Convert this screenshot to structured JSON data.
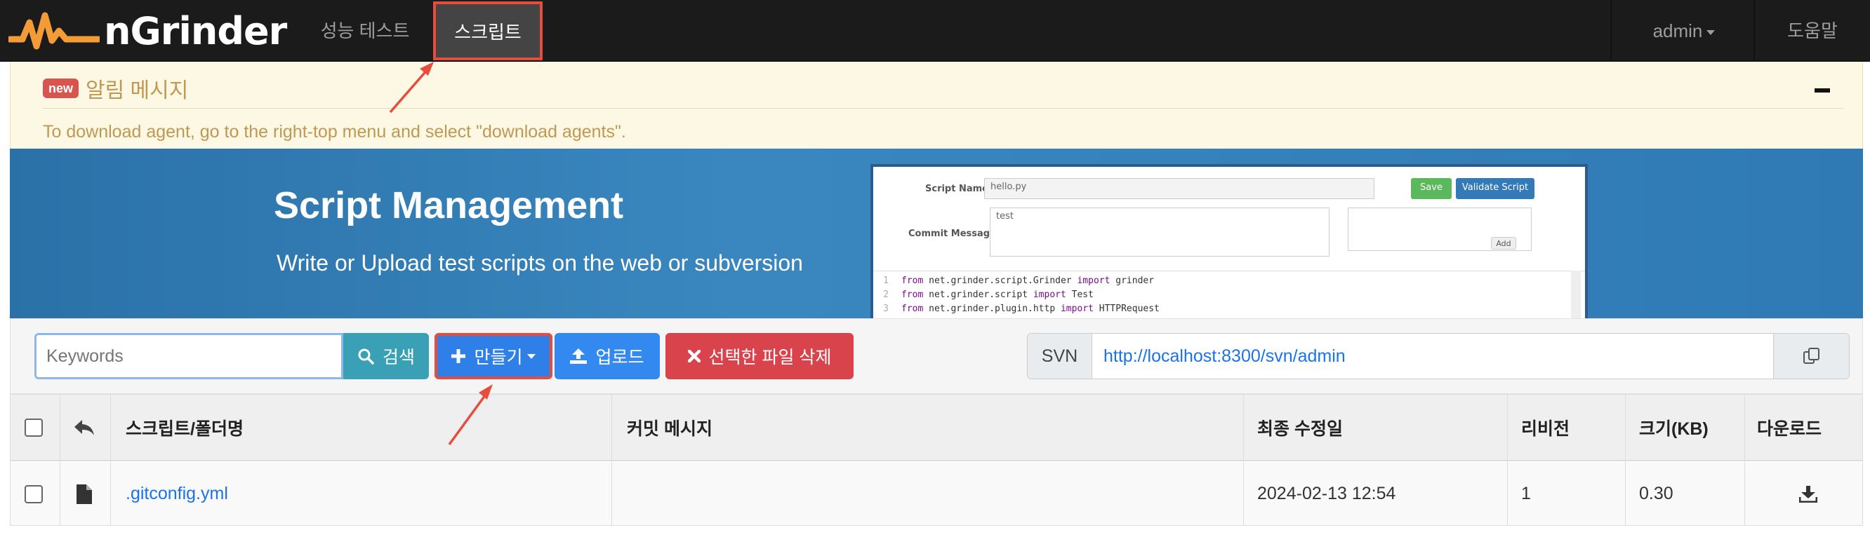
{
  "navbar": {
    "brand": "nGrinder",
    "menu": [
      {
        "label": "성능 테스트"
      },
      {
        "label": "스크립트",
        "active": true
      }
    ],
    "user": "admin",
    "help": "도움말"
  },
  "alert": {
    "badge": "new",
    "title": "알림 메시지",
    "message": "To download agent, go to the right-top menu and select \"download agents\"."
  },
  "banner": {
    "title": "Script Management",
    "subtitle": "Write or Upload test scripts on the web or subversion",
    "preview": {
      "script_name_label": "Script Name",
      "script_name_value": "hello.py",
      "save": "Save",
      "validate": "Validate Script",
      "commit_label": "Commit Message",
      "commit_value": "test",
      "add": "Add",
      "code": [
        {
          "num": "1",
          "kw1": "from",
          "mid": " net.grinder.script.Grinder ",
          "kw2": "import",
          "end": " grinder"
        },
        {
          "num": "2",
          "kw1": "from",
          "mid": " net.grinder.script ",
          "kw2": "import",
          "end": " Test"
        },
        {
          "num": "3",
          "kw1": "from",
          "mid": " net.grinder.plugin.http ",
          "kw2": "import",
          "end": " HTTPRequest"
        }
      ]
    }
  },
  "toolbar": {
    "search_placeholder": "Keywords",
    "search_button": "검색",
    "create_button": "만들기",
    "upload_button": "업로드",
    "delete_button": "선택한 파일 삭제",
    "svn_label": "SVN",
    "svn_url": "http://localhost:8300/svn/admin"
  },
  "table": {
    "headers": {
      "name": "스크립트/폴더명",
      "commit": "커밋 메시지",
      "modified": "최종 수정일",
      "revision": "리비전",
      "size": "크기(KB)",
      "download": "다운로드"
    },
    "rows": [
      {
        "name": ".gitconfig.yml",
        "commit": "",
        "modified": "2024-02-13 12:54",
        "revision": "1",
        "size": "0.30"
      }
    ]
  },
  "colors": {
    "navbar_bg": "#1b1b1b",
    "highlight_border": "#e74c3c",
    "alert_bg": "#fcf8e3",
    "alert_text": "#c09853",
    "banner_bg": "#2f7ab5",
    "btn_search": "#3aa0b5",
    "btn_primary": "#2f7fe8",
    "btn_danger": "#d9434b",
    "link": "#1a73e8"
  },
  "icons": [
    "ngrinder-logo-icon",
    "caret-down-icon",
    "collapse-icon",
    "search-icon",
    "plus-icon",
    "upload-icon",
    "remove-icon",
    "copy-icon",
    "reply-icon",
    "file-icon",
    "download-icon",
    "arrow-annotation"
  ]
}
